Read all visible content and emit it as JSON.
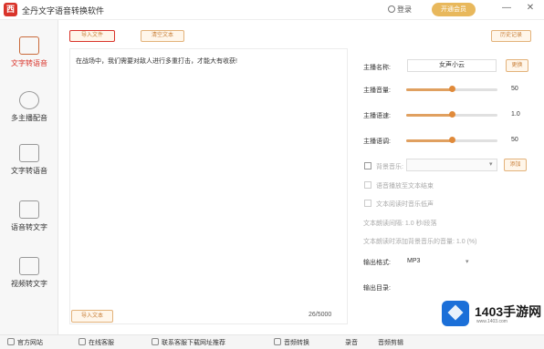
{
  "app": {
    "title": "全丹文字语音转换软件",
    "logo_char": "西",
    "login": "登录",
    "vip": "开通会员",
    "min": "—",
    "close": "✕",
    "accent": "#d9342b"
  },
  "sidebar": {
    "items": [
      {
        "label": "文字转语音",
        "icon": "text-to-speech-icon"
      },
      {
        "label": "多主播配音",
        "icon": "multi-anchor-icon"
      },
      {
        "label": "文字转语音",
        "icon": "document-icon"
      },
      {
        "label": "语音转文字",
        "icon": "speech-to-text-icon"
      },
      {
        "label": "视频转文字",
        "icon": "video-to-text-icon"
      }
    ]
  },
  "editor": {
    "btn_left": "导入文件",
    "btn_mid": "清空文本",
    "btn_right": "历史记录",
    "text": "在战场中，我们需要对敌人进行多重打击，才能大有收获!",
    "import_btn": "导入文本",
    "counter": "26/5000"
  },
  "settings": {
    "anchor_label": "主播名称:",
    "anchor_value": "女声小云",
    "change_btn": "更换",
    "volume_label": "主播音量:",
    "volume_value": "50",
    "speed_label": "主播语速:",
    "speed_value": "1.0",
    "pitch_label": "主播语调:",
    "pitch_value": "50",
    "bgm_label": "背景音乐:",
    "bgm_btn": "添加",
    "opt1": "语音播放至文本结束",
    "opt2": "文本阅读时音乐低声",
    "opt3": "文本朗读间隔: 1.0 秒/段落",
    "opt4": "文本朗读时添加背景音乐的音量: 1.0 (%)",
    "format_label": "输出格式:",
    "format_value": "MP3",
    "out_label": "输出目录:"
  },
  "bottombar": {
    "site": "官方网站",
    "service": "在线客服",
    "recommend": "联系客服下载网址推荐",
    "convert": "音频转换",
    "more1": "录音",
    "more2": "音频剪辑"
  },
  "watermark": {
    "text": "1403手游网",
    "url": "www.1403.com"
  }
}
